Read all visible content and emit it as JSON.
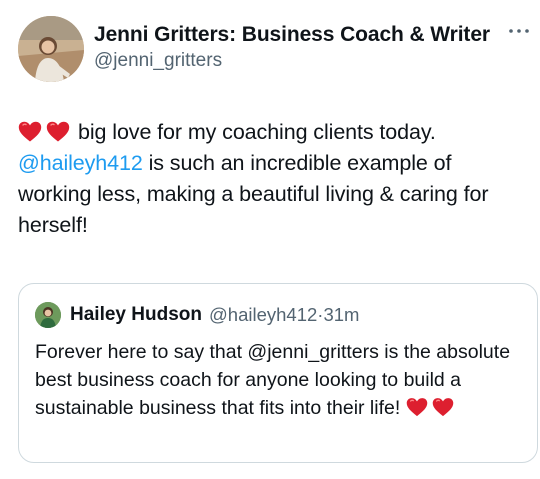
{
  "tweet": {
    "author": {
      "display_name": "Jenni Gritters: Business Coach & Writer",
      "handle": "@jenni_gritters"
    },
    "more_icon": "more-horizontal-icon",
    "text_line1": "big love for my coaching clients today.",
    "mention": "@haileyh412",
    "text_rest": " is such an incredible example of working less, making a beautiful living & caring for herself!",
    "leading_emoji": [
      "heart-emoji",
      "heart-emoji"
    ]
  },
  "quote": {
    "author": {
      "display_name": "Hailey Hudson",
      "handle": "@haileyh412",
      "separator": "·",
      "time": "31m"
    },
    "text": "Forever here to say that @jenni_gritters is the absolute best business coach for anyone looking to build a sustainable business that fits into their life!",
    "trailing_emoji": [
      "heart-emoji",
      "heart-emoji"
    ]
  },
  "colors": {
    "text": "#0f1419",
    "secondary": "#536471",
    "link": "#1d9bf0",
    "border": "#cfd9de",
    "heart": "#e0122f"
  }
}
